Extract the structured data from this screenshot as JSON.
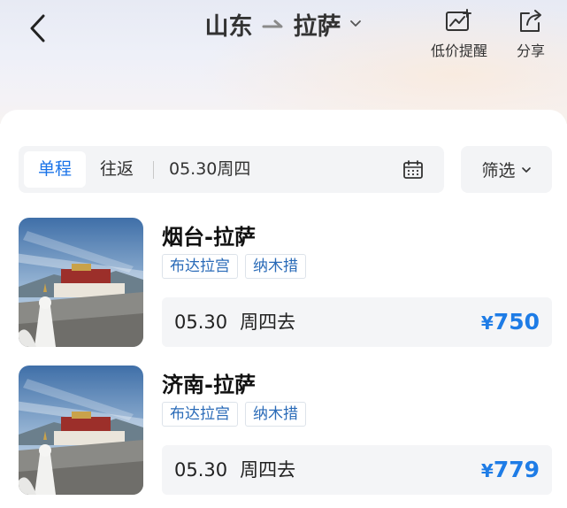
{
  "header": {
    "origin": "山东",
    "destination": "拉萨",
    "actions": [
      {
        "label": "低价提醒",
        "icon": "price-chart-icon"
      },
      {
        "label": "分享",
        "icon": "share-icon"
      }
    ]
  },
  "tabs": {
    "oneway": "单程",
    "roundtrip": "往返",
    "active": "单程",
    "date": "05.30周四"
  },
  "filter": {
    "label": "筛选"
  },
  "routes": [
    {
      "title": "烟台-拉萨",
      "tags": [
        "布达拉宫",
        "纳木措"
      ],
      "date": "05.30",
      "weekday": "周四去",
      "currency": "¥",
      "price": "750"
    },
    {
      "title": "济南-拉萨",
      "tags": [
        "布达拉宫",
        "纳木措"
      ],
      "date": "05.30",
      "weekday": "周四去",
      "currency": "¥",
      "price": "779"
    }
  ],
  "colors": {
    "accent": "#1a73e8",
    "price": "#1e7ce6",
    "tag_text": "#2a6bb8"
  }
}
